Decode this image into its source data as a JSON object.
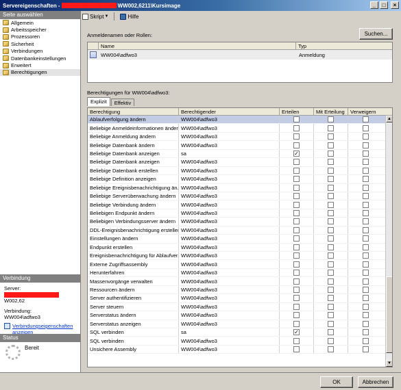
{
  "window": {
    "title_prefix": "Servereigenschaften -",
    "title_suffix": "WW002,6211\\Kursimage"
  },
  "toolbar": {
    "script_label": "Skript",
    "help_label": "Hilfe"
  },
  "sidebar": {
    "header": "Seite auswählen",
    "items": [
      {
        "label": "Allgemein"
      },
      {
        "label": "Arbeitsspeicher"
      },
      {
        "label": "Prozessoren"
      },
      {
        "label": "Sicherheit"
      },
      {
        "label": "Verbindungen"
      },
      {
        "label": "Datenbankeinstellungen"
      },
      {
        "label": "Erweitert"
      },
      {
        "label": "Berechtigungen"
      }
    ]
  },
  "connection": {
    "header": "Verbindung",
    "server_label": "Server:",
    "server_value_suffix": "W002,62",
    "connection_label": "Verbindung:",
    "connection_value": "WW004\\adfwo3",
    "link_line1": "Verbindungseigenschaften",
    "link_line2": "anzeigen"
  },
  "status": {
    "header": "Status",
    "value": "Bereit"
  },
  "logins": {
    "label": "Anmeldenamen oder Rollen:",
    "search_button": "Suchen...",
    "columns": {
      "name": "Name",
      "type": "Typ"
    },
    "rows": [
      {
        "name": "WW004\\adfwo3",
        "type": "Anmeldung"
      }
    ]
  },
  "permissions": {
    "label": "Berechtigungen für WW004\\adfwo3:",
    "tabs": [
      "Explizit",
      "Effektiv"
    ],
    "columns": {
      "permission": "Berechtigung",
      "grantor": "Berechtigender",
      "grant": "Erteilen",
      "with_grant": "Mit Erteilung",
      "deny": "Verweigern"
    },
    "rows": [
      {
        "permission": "Ablaufverfolgung ändern",
        "grantor": "WW004\\adfwo3",
        "grant": false,
        "with_grant": false,
        "deny": false
      },
      {
        "permission": "Beliebige Anmeldeinformationen ändern",
        "grantor": "WW004\\adfwo3",
        "grant": false,
        "with_grant": false,
        "deny": false
      },
      {
        "permission": "Beliebige Anmeldung ändern",
        "grantor": "WW004\\adfwo3",
        "grant": false,
        "with_grant": false,
        "deny": false
      },
      {
        "permission": "Beliebige Datenbank ändern",
        "grantor": "WW004\\adfwo3",
        "grant": false,
        "with_grant": false,
        "deny": false
      },
      {
        "permission": "Beliebige Datenbank anzeigen",
        "grantor": "sa",
        "grant": true,
        "with_grant": false,
        "deny": false
      },
      {
        "permission": "Beliebige Datenbank anzeigen",
        "grantor": "WW004\\adfwo3",
        "grant": false,
        "with_grant": false,
        "deny": false
      },
      {
        "permission": "Beliebige Datenbank erstellen",
        "grantor": "WW004\\adfwo3",
        "grant": false,
        "with_grant": false,
        "deny": false
      },
      {
        "permission": "Beliebige Definition anzeigen",
        "grantor": "WW004\\adfwo3",
        "grant": false,
        "with_grant": false,
        "deny": false
      },
      {
        "permission": "Beliebige Ereignisbenachrichtigung än...",
        "grantor": "WW004\\adfwo3",
        "grant": false,
        "with_grant": false,
        "deny": false
      },
      {
        "permission": "Beliebige Serverüberwachung ändern",
        "grantor": "WW004\\adfwo3",
        "grant": false,
        "with_grant": false,
        "deny": false
      },
      {
        "permission": "Beliebige Verbindung ändern",
        "grantor": "WW004\\adfwo3",
        "grant": false,
        "with_grant": false,
        "deny": false
      },
      {
        "permission": "Beliebigen Endpunkt ändern",
        "grantor": "WW004\\adfwo3",
        "grant": false,
        "with_grant": false,
        "deny": false
      },
      {
        "permission": "Beliebigen Verbindungsserver ändern",
        "grantor": "WW004\\adfwo3",
        "grant": false,
        "with_grant": false,
        "deny": false
      },
      {
        "permission": "DDL-Ereignisbenachrichtigung erstellen",
        "grantor": "WW004\\adfwo3",
        "grant": false,
        "with_grant": false,
        "deny": false
      },
      {
        "permission": "Einstellungen ändern",
        "grantor": "WW004\\adfwo3",
        "grant": false,
        "with_grant": false,
        "deny": false
      },
      {
        "permission": "Endpunkt erstellen",
        "grantor": "WW004\\adfwo3",
        "grant": false,
        "with_grant": false,
        "deny": false
      },
      {
        "permission": "Ereignisbenachrichtigung für Ablaufver...",
        "grantor": "WW004\\adfwo3",
        "grant": false,
        "with_grant": false,
        "deny": false
      },
      {
        "permission": "Externe Zugriffsassembly",
        "grantor": "WW004\\adfwo3",
        "grant": false,
        "with_grant": false,
        "deny": false
      },
      {
        "permission": "Herunterfahren",
        "grantor": "WW004\\adfwo3",
        "grant": false,
        "with_grant": false,
        "deny": false
      },
      {
        "permission": "Massenvorgänge verwalten",
        "grantor": "WW004\\adfwo3",
        "grant": false,
        "with_grant": false,
        "deny": false
      },
      {
        "permission": "Ressourcen ändern",
        "grantor": "WW004\\adfwo3",
        "grant": false,
        "with_grant": false,
        "deny": false
      },
      {
        "permission": "Server authentifizieren",
        "grantor": "WW004\\adfwo3",
        "grant": false,
        "with_grant": false,
        "deny": false
      },
      {
        "permission": "Server steuern",
        "grantor": "WW004\\adfwo3",
        "grant": false,
        "with_grant": false,
        "deny": false
      },
      {
        "permission": "Serverstatus ändern",
        "grantor": "WW004\\adfwo3",
        "grant": false,
        "with_grant": false,
        "deny": false
      },
      {
        "permission": "Serverstatus anzeigen",
        "grantor": "WW004\\adfwo3",
        "grant": false,
        "with_grant": false,
        "deny": false
      },
      {
        "permission": "SQL verbinden",
        "grantor": "sa",
        "grant": true,
        "with_grant": false,
        "deny": false
      },
      {
        "permission": "SQL verbinden",
        "grantor": "WW004\\adfwo3",
        "grant": false,
        "with_grant": false,
        "deny": false
      },
      {
        "permission": "Unsichere Assembly",
        "grantor": "WW004\\adfwo3",
        "grant": false,
        "with_grant": false,
        "deny": false
      }
    ]
  },
  "footer": {
    "ok_label": "OK",
    "cancel_label": "Abbrechen"
  },
  "colors": {
    "titlebar_start": "#0a246a",
    "redaction": "#ff1a1a",
    "selected_row": "#c3cce5",
    "link": "#0033cc"
  }
}
